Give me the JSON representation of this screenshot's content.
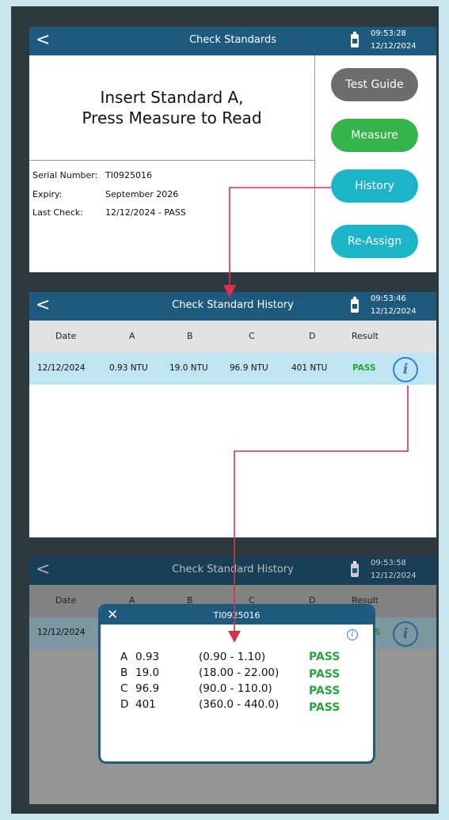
{
  "screen1": {
    "header": {
      "back": "<",
      "title": "Check Standards",
      "time": "09:53:28",
      "date": "12/12/2024"
    },
    "message_line1": "Insert Standard A,",
    "message_line2": "Press Measure to Read",
    "info": [
      {
        "label": "Serial Number:",
        "value": "TI0925016"
      },
      {
        "label": "Expiry:",
        "value": "September 2026"
      },
      {
        "label": "Last Check:",
        "value": "12/12/2024 - PASS"
      }
    ],
    "buttons": {
      "test_guide": "Test Guide",
      "measure": "Measure",
      "history": "History",
      "reassign": "Re-Assign"
    },
    "colors": {
      "header": "#1e5a7e",
      "test_guide": "#6d6d6d",
      "measure": "#34b44a",
      "history": "#1cb5c8",
      "reassign": "#1cb5c8"
    }
  },
  "screen2": {
    "header": {
      "back": "<",
      "title": "Check Standard History",
      "time": "09:53:46",
      "date": "12/12/2024"
    },
    "columns": [
      "Date",
      "A",
      "B",
      "C",
      "D",
      "Result"
    ],
    "rows": [
      {
        "date": "12/12/2024",
        "a": "0.93 NTU",
        "b": "19.0 NTU",
        "c": "96.9 NTU",
        "d": "401 NTU",
        "result": "PASS",
        "icon": "info-icon"
      }
    ]
  },
  "screen3": {
    "header": {
      "back": "<",
      "title": "Check Standard History",
      "time": "09:53:58",
      "date": "12/12/2024"
    },
    "columns": [
      "Date",
      "A",
      "B",
      "C",
      "D",
      "Result"
    ],
    "row": {
      "date": "12/12/2024",
      "result_partial": "S"
    },
    "dialog": {
      "close": "✕",
      "title": "TI0925016",
      "results": [
        {
          "letter": "A",
          "value": "0.93",
          "range": "(0.90 - 1.10)",
          "result": "PASS"
        },
        {
          "letter": "B",
          "value": "19.0",
          "range": "(18.00 - 22.00)",
          "result": "PASS"
        },
        {
          "letter": "C",
          "value": "96.9",
          "range": "(90.0 - 110.0)",
          "result": "PASS"
        },
        {
          "letter": "D",
          "value": "401",
          "range": "(360.0 - 440.0)",
          "result": "PASS"
        }
      ]
    }
  },
  "annotation_color": "#d9304e"
}
